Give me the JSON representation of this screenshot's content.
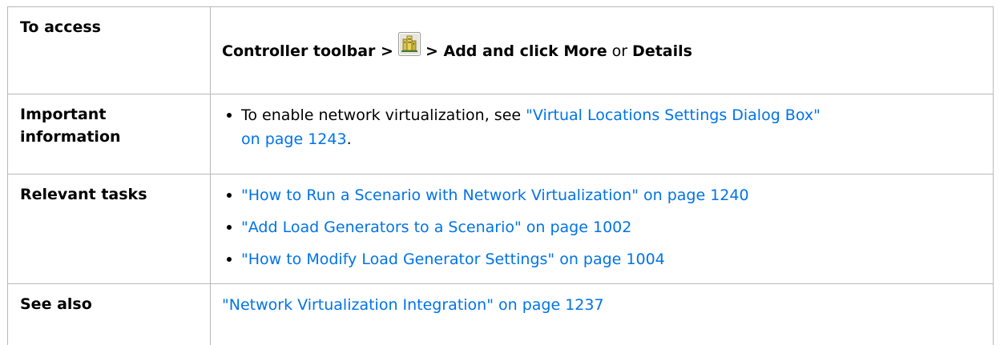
{
  "rows": {
    "access": {
      "label": "To access",
      "prefix": "Controller toolbar >",
      "icon": "load-generators-toolbar-icon",
      "suffix": "> Add and click More",
      "or": "or",
      "details": "Details"
    },
    "important": {
      "label_line1": "Important",
      "label_line2": "information",
      "bullet_text": "To enable network virtualization, see ",
      "bullet_link_line1": "\"Virtual Locations Settings Dialog Box\"",
      "bullet_link_line2": "on page 1243",
      "bullet_tail": "."
    },
    "tasks": {
      "label": "Relevant tasks",
      "items": [
        "\"How to Run a Scenario with Network Virtualization\" on page 1240",
        "\"Add Load Generators to a Scenario\" on page 1002",
        "\"How to Modify Load Generator Settings\" on page 1004"
      ]
    },
    "see_also": {
      "label": "See also",
      "link": "\"Network Virtualization Integration\" on page 1237"
    }
  },
  "colors": {
    "link": "#0073e7",
    "border": "#b8b8b8",
    "text": "#000000"
  }
}
